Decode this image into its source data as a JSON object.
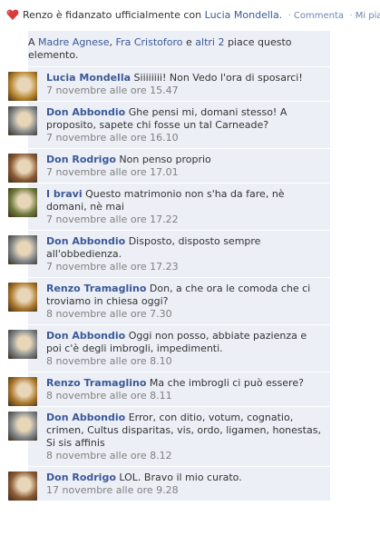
{
  "header": {
    "name": "Renzo",
    "status_text": "è fidanzato ufficialmente con",
    "partner": "Lucia Mondella.",
    "comment_link": "Commenta",
    "like_link": "Mi piace"
  },
  "likes": {
    "prefix": "A",
    "person1": "Madre Agnese",
    "sep": ",",
    "person2": "Fra Cristoforo",
    "conj": "e",
    "others": "altri 2",
    "suffix": "piace questo elemento."
  },
  "comments": [
    {
      "author": "Lucia Mondella",
      "text": "Siiiiiiii! Non Vedo l'ora di sposarci!",
      "time": "7 novembre alle ore 15.47",
      "avatar_color": "#b8862e"
    },
    {
      "author": "Don Abbondio",
      "text": "Ghe pensi mi, domani stesso! A proposito, sapete chi fosse un tal Carneade?",
      "time": "7 novembre alle ore 16.10",
      "avatar_color": "#7d8386"
    },
    {
      "author": "Don Rodrigo",
      "text": "Non penso proprio",
      "time": "7 novembre alle ore 17.01",
      "avatar_color": "#8a5a34"
    },
    {
      "author": "I bravi",
      "text": "Questo matrimonio non s'ha da fare, nè domani, nè mai",
      "time": "7 novembre alle ore 17.22",
      "avatar_color": "#6e7a3c"
    },
    {
      "author": "Don Abbondio",
      "text": "Disposto, disposto sempre all'obbedienza.",
      "time": "7 novembre alle ore 17.23",
      "avatar_color": "#7d8386"
    },
    {
      "author": "Renzo Tramaglino",
      "text": "Don, a che ora le comoda che ci troviamo in chiesa oggi?",
      "time": "8 novembre alle ore 7.30",
      "avatar_color": "#a9772a"
    },
    {
      "author": "Don Abbondio",
      "text": "Oggi non posso, abbiate pazienza e poi c'è degli imbrogli, impedimenti.",
      "time": "8 novembre alle ore 8.10",
      "avatar_color": "#7d8386"
    },
    {
      "author": "Renzo Tramaglino",
      "text": "Ma che imbrogli ci può essere?",
      "time": "8 novembre alle ore 8.11",
      "avatar_color": "#a9772a"
    },
    {
      "author": "Don Abbondio",
      "text": "Error, con ditio, votum, cognatio, crimen, Cultus disparitas, vis, ordo, ligamen, honestas, Si sis affinis",
      "time": "8 novembre alle ore 8.12",
      "avatar_color": "#7d8386"
    },
    {
      "author": "Don Rodrigo",
      "text": "LOL. Bravo il mio curato.",
      "time": "17 novembre alle ore 9.28",
      "avatar_color": "#8a5a34"
    }
  ]
}
